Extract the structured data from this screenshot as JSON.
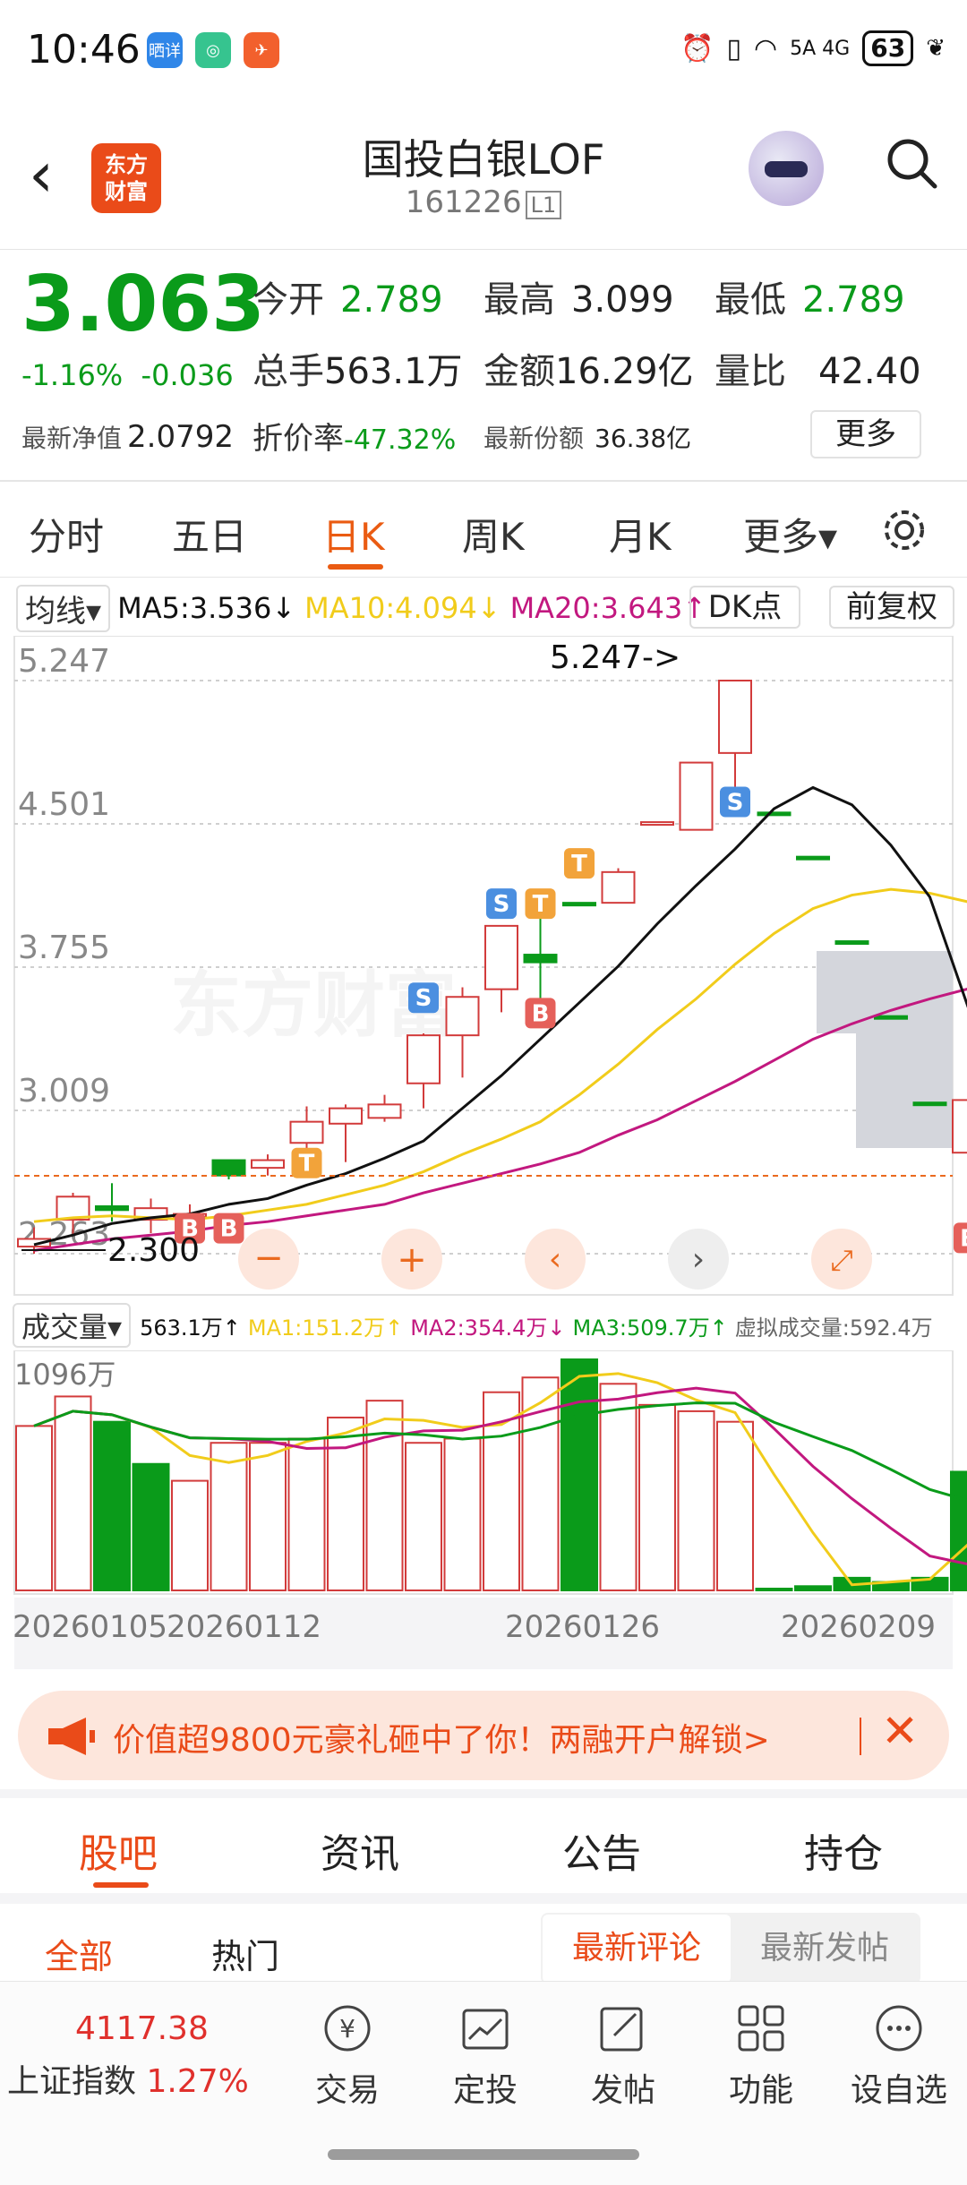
{
  "status_bar": {
    "time": "10:46",
    "app_icons": [
      "晒详",
      "camera-app",
      "flag-app"
    ],
    "network": "5A 4G",
    "battery": "63"
  },
  "header": {
    "back": "<",
    "logo": "东方财富",
    "title": "国投白银LOF",
    "code": "161226",
    "level": "L1"
  },
  "quote": {
    "price": "3.063",
    "change_pct": "-1.16%",
    "change": "-0.036",
    "open_label": "今开",
    "open": "2.789",
    "high_label": "最高",
    "high": "3.099",
    "low_label": "最低",
    "low": "2.789",
    "volume_label": "总手",
    "volume": "563.1万",
    "amount_label": "金额",
    "amount": "16.29亿",
    "ratio_label": "量比",
    "ratio": "42.40",
    "nav_label": "最新净值",
    "nav": "2.0792",
    "discount_label": "折价率",
    "discount": "-47.32%",
    "shares_label": "最新份额",
    "shares": "36.38亿",
    "more": "更多"
  },
  "ktabs": {
    "items": [
      "分时",
      "五日",
      "日K",
      "周K",
      "月K",
      "更多▾"
    ],
    "active": "日K"
  },
  "ma": {
    "selector": "均线▾",
    "ma5": "MA5:3.536↓",
    "ma10": "MA10:4.094↓",
    "ma20": "MA20:3.643↑",
    "dk": "DK点",
    "fq": "前复权",
    "colors": {
      "ma5": "#111111",
      "ma10": "#f1cc1b",
      "ma20": "#c2187f"
    }
  },
  "chart_axis": {
    "y_labels": [
      "5.247",
      "4.501",
      "3.755",
      "3.009",
      "2.263"
    ],
    "max_note": "5.247->",
    "min_note": "2.300",
    "markers": [
      "S",
      "S",
      "S",
      "T",
      "T",
      "T",
      "B",
      "B",
      "B",
      "B"
    ]
  },
  "volume": {
    "selector": "成交量▾",
    "vol": "563.1万↑",
    "ma1": "MA1:151.2万↑",
    "ma2": "MA2:354.4万↓",
    "ma3": "MA3:509.7万↑",
    "virtual": "虚拟成交量:592.4万",
    "max_label": "1096万",
    "dates": [
      "20260105",
      "20260112",
      "20260126",
      "20260209"
    ]
  },
  "chart_data": {
    "type": "candlestick",
    "ylim": [
      2.263,
      5.247
    ],
    "candles": [
      {
        "o": 2.3,
        "h": 2.4,
        "l": 2.263,
        "c": 2.34,
        "up": true
      },
      {
        "o": 2.44,
        "h": 2.58,
        "l": 2.36,
        "c": 2.56,
        "up": true
      },
      {
        "o": 2.51,
        "h": 2.63,
        "l": 2.43,
        "c": 2.49,
        "up": false
      },
      {
        "o": 2.44,
        "h": 2.55,
        "l": 2.37,
        "c": 2.5,
        "up": true
      },
      {
        "o": 2.46,
        "h": 2.52,
        "l": 2.4,
        "c": 2.47,
        "up": true
      },
      {
        "o": 2.75,
        "h": 2.75,
        "l": 2.65,
        "c": 2.67,
        "up": false
      },
      {
        "o": 2.71,
        "h": 2.78,
        "l": 2.67,
        "c": 2.75,
        "up": true
      },
      {
        "o": 2.84,
        "h": 3.03,
        "l": 2.74,
        "c": 2.95,
        "up": true
      },
      {
        "o": 2.94,
        "h": 3.04,
        "l": 2.74,
        "c": 3.02,
        "up": true
      },
      {
        "o": 2.97,
        "h": 3.09,
        "l": 2.95,
        "c": 3.04,
        "up": true
      },
      {
        "o": 3.15,
        "h": 3.41,
        "l": 3.02,
        "c": 3.4,
        "up": true
      },
      {
        "o": 3.4,
        "h": 3.65,
        "l": 3.18,
        "c": 3.6,
        "up": true
      },
      {
        "o": 3.64,
        "h": 3.97,
        "l": 3.52,
        "c": 3.97,
        "up": true
      },
      {
        "o": 3.82,
        "h": 4.09,
        "l": 3.52,
        "c": 3.78,
        "up": false
      },
      {
        "o": 4.09,
        "h": 4.09,
        "l": 4.09,
        "c": 4.09,
        "up": false
      },
      {
        "o": 4.09,
        "h": 4.27,
        "l": 4.09,
        "c": 4.25,
        "up": true
      },
      {
        "o": 4.51,
        "h": 4.51,
        "l": 4.51,
        "c": 4.51,
        "up": true
      },
      {
        "o": 4.47,
        "h": 4.82,
        "l": 4.47,
        "c": 4.82,
        "up": true
      },
      {
        "o": 4.87,
        "h": 5.247,
        "l": 4.62,
        "c": 5.247,
        "up": true
      },
      {
        "o": 4.56,
        "h": 4.56,
        "l": 4.56,
        "c": 4.56,
        "up": false
      },
      {
        "o": 4.33,
        "h": 4.33,
        "l": 4.33,
        "c": 4.33,
        "up": false
      },
      {
        "o": 3.89,
        "h": 3.89,
        "l": 3.89,
        "c": 3.89,
        "up": false
      },
      {
        "o": 3.5,
        "h": 3.5,
        "l": 3.5,
        "c": 3.5,
        "up": false
      },
      {
        "o": 3.05,
        "h": 3.05,
        "l": 3.05,
        "c": 3.05,
        "up": false
      },
      {
        "o": 2.789,
        "h": 3.099,
        "l": 2.789,
        "c": 3.063,
        "up": true
      }
    ],
    "ma5": [
      2.31,
      2.36,
      2.42,
      2.45,
      2.47,
      2.52,
      2.55,
      2.62,
      2.68,
      2.76,
      2.85,
      3.02,
      3.19,
      3.38,
      3.57,
      3.76,
      3.98,
      4.18,
      4.37,
      4.58,
      4.69,
      4.6,
      4.39,
      4.12,
      3.536
    ],
    "ma10": [
      2.43,
      2.45,
      2.46,
      2.45,
      2.44,
      2.46,
      2.49,
      2.52,
      2.57,
      2.62,
      2.69,
      2.78,
      2.86,
      2.95,
      3.09,
      3.25,
      3.43,
      3.59,
      3.77,
      3.93,
      4.06,
      4.13,
      4.16,
      4.14,
      4.094
    ],
    "ma20": [
      2.28,
      2.31,
      2.34,
      2.36,
      2.38,
      2.41,
      2.43,
      2.46,
      2.49,
      2.52,
      2.58,
      2.63,
      2.68,
      2.73,
      2.79,
      2.88,
      2.96,
      3.06,
      3.16,
      3.27,
      3.38,
      3.46,
      3.53,
      3.59,
      3.643
    ],
    "volumes": [
      780,
      920,
      800,
      600,
      520,
      700,
      700,
      720,
      820,
      900,
      700,
      720,
      940,
      1010,
      1096,
      980,
      880,
      850,
      800,
      0,
      20,
      60,
      40,
      60,
      563
    ],
    "vol_up": [
      true,
      true,
      false,
      false,
      true,
      true,
      true,
      true,
      true,
      true,
      true,
      true,
      true,
      true,
      false,
      true,
      true,
      true,
      true,
      false,
      false,
      false,
      false,
      false,
      false
    ]
  },
  "ad": {
    "text": "价值超9800元豪礼砸中了你！两融开户解锁>",
    "close": "✕"
  },
  "bottom_tabs": {
    "items": [
      "股吧",
      "资讯",
      "公告",
      "持仓"
    ],
    "active": "股吧"
  },
  "filter": {
    "all": "全部",
    "hot": "热门",
    "latest_comment": "最新评论",
    "latest_post": "最新发帖"
  },
  "index": {
    "value": "4117.38",
    "name": "上证指数",
    "pct": "1.27%"
  },
  "nav": [
    {
      "label": "交易",
      "icon": "trade-icon"
    },
    {
      "label": "定投",
      "icon": "invest-plan-icon"
    },
    {
      "label": "发帖",
      "icon": "post-icon"
    },
    {
      "label": "功能",
      "icon": "grid-icon"
    },
    {
      "label": "设自选",
      "icon": "more-dots-icon"
    }
  ]
}
